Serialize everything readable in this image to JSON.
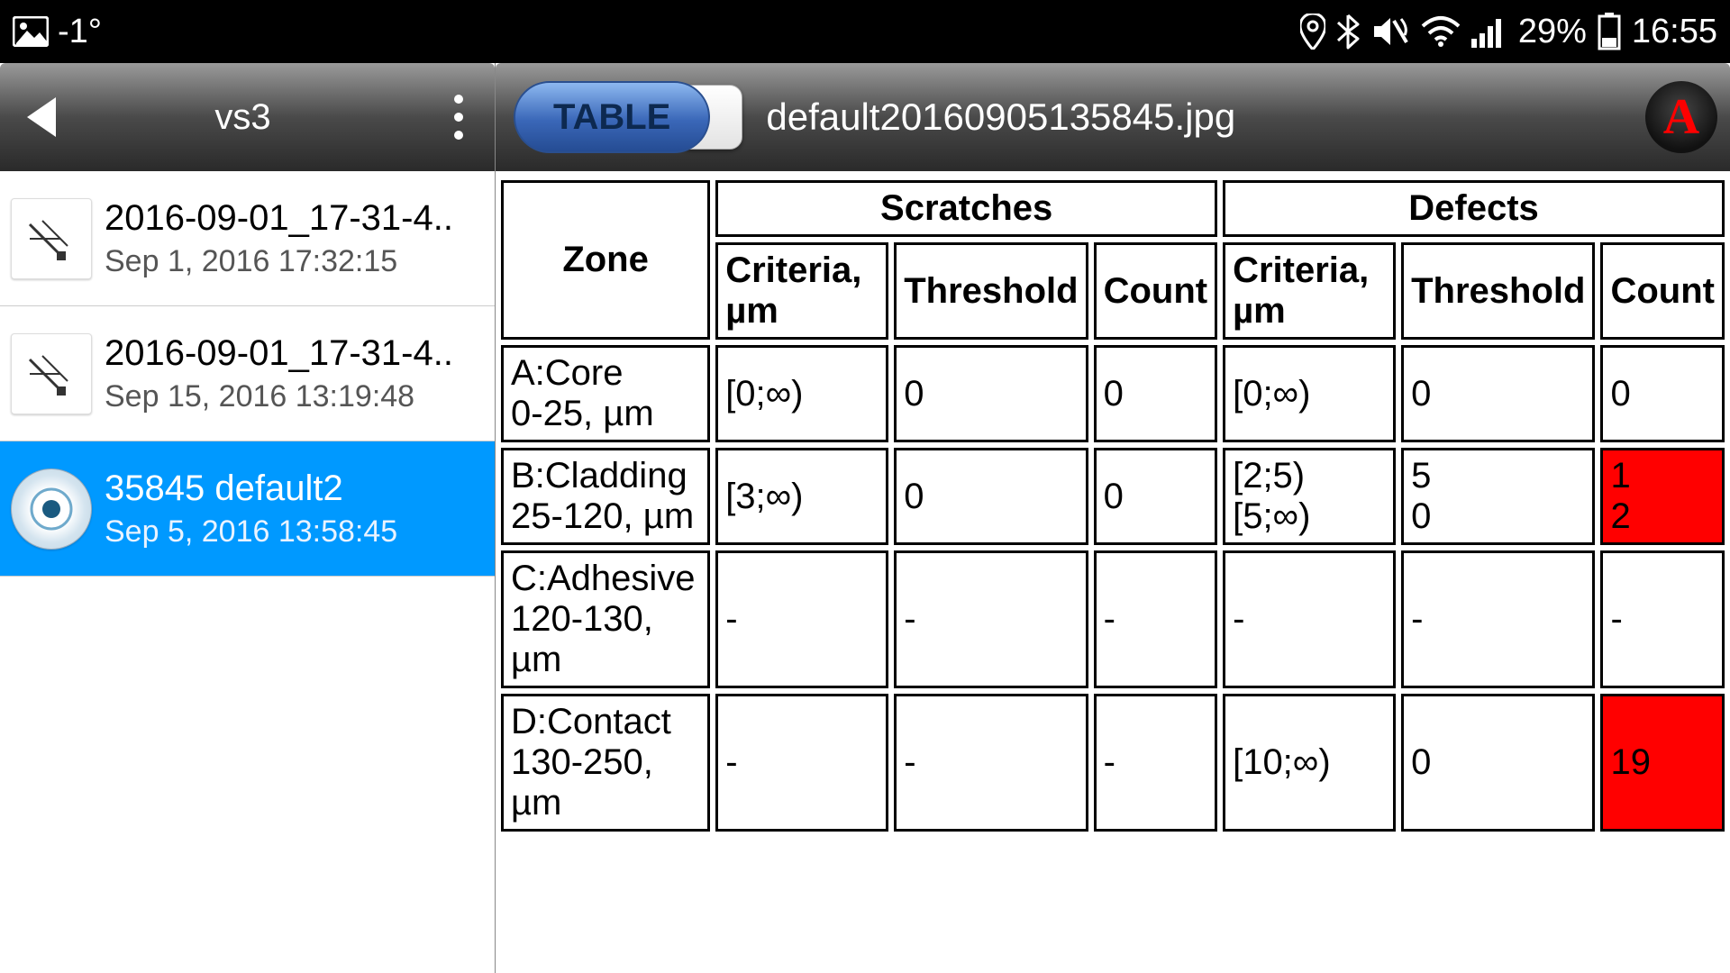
{
  "statusbar": {
    "temperature": "-1°",
    "battery_pct": "29%",
    "time": "16:55"
  },
  "left": {
    "title": "vs3",
    "items": [
      {
        "title": "2016-09-01_17-31-4..",
        "subtitle": "Sep 1, 2016 17:32:15",
        "selected": false
      },
      {
        "title": "2016-09-01_17-31-4..",
        "subtitle": "Sep 15, 2016 13:19:48",
        "selected": false
      },
      {
        "title": "35845            default2",
        "subtitle": "Sep 5, 2016 13:58:45",
        "selected": true
      }
    ]
  },
  "right": {
    "toggle_label": "TABLE",
    "filename": "default20160905135845.jpg",
    "logo_letter": "A",
    "headers": {
      "zone": "Zone",
      "scratches": "Scratches",
      "defects": "Defects",
      "criteria": "Criteria, µm",
      "threshold": "Threshold",
      "count": "Count"
    },
    "rows": [
      {
        "zone": "A:Core\n0-25, µm",
        "s_criteria": "[0;∞)",
        "s_threshold": "0",
        "s_count": "0",
        "d_criteria": "[0;∞)",
        "d_threshold": "0",
        "d_count": "0",
        "d_count_alert": false
      },
      {
        "zone": "B:Cladding\n25-120, µm",
        "s_criteria": "[3;∞)",
        "s_threshold": "0",
        "s_count": "0",
        "d_criteria": "[2;5)\n[5;∞)",
        "d_threshold": "5\n0",
        "d_count": "1\n2",
        "d_count_alert": true
      },
      {
        "zone": "C:Adhesive\n120-130, µm",
        "s_criteria": "-",
        "s_threshold": "-",
        "s_count": "-",
        "d_criteria": "-",
        "d_threshold": "-",
        "d_count": "-",
        "d_count_alert": false
      },
      {
        "zone": "D:Contact\n130-250, µm",
        "s_criteria": "-",
        "s_threshold": "-",
        "s_count": "-",
        "d_criteria": "[10;∞)",
        "d_threshold": "0",
        "d_count": "19",
        "d_count_alert": true
      }
    ]
  }
}
